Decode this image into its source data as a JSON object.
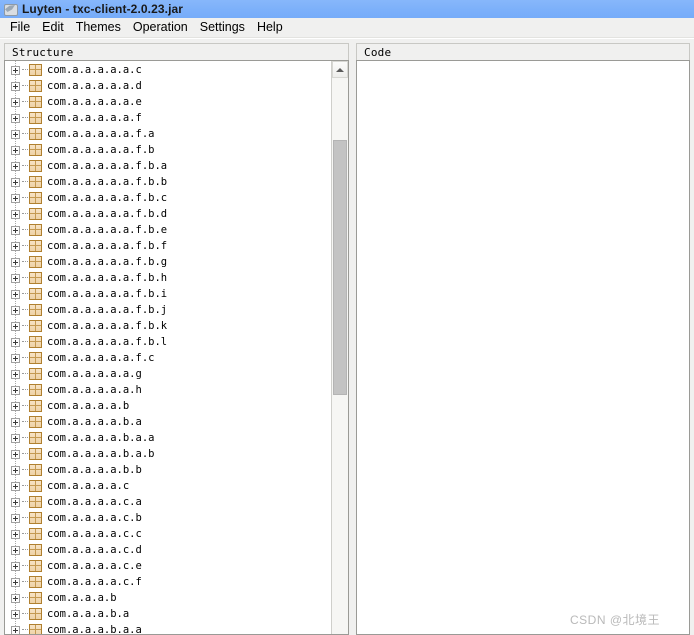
{
  "window": {
    "title": "Luyten - txc-client-2.0.23.jar",
    "icon": "app-icon"
  },
  "menubar": {
    "items": [
      {
        "label": "File"
      },
      {
        "label": "Edit"
      },
      {
        "label": "Themes"
      },
      {
        "label": "Operation"
      },
      {
        "label": "Settings"
      },
      {
        "label": "Help"
      }
    ]
  },
  "structure_panel": {
    "header": "Structure",
    "expander_icon": "plus-square-icon",
    "node_icon": "package-icon",
    "nodes": [
      {
        "label": "com.a.a.a.a.a.c"
      },
      {
        "label": "com.a.a.a.a.a.d"
      },
      {
        "label": "com.a.a.a.a.a.e"
      },
      {
        "label": "com.a.a.a.a.a.f"
      },
      {
        "label": "com.a.a.a.a.a.f.a"
      },
      {
        "label": "com.a.a.a.a.a.f.b"
      },
      {
        "label": "com.a.a.a.a.a.f.b.a"
      },
      {
        "label": "com.a.a.a.a.a.f.b.b"
      },
      {
        "label": "com.a.a.a.a.a.f.b.c"
      },
      {
        "label": "com.a.a.a.a.a.f.b.d"
      },
      {
        "label": "com.a.a.a.a.a.f.b.e"
      },
      {
        "label": "com.a.a.a.a.a.f.b.f"
      },
      {
        "label": "com.a.a.a.a.a.f.b.g"
      },
      {
        "label": "com.a.a.a.a.a.f.b.h"
      },
      {
        "label": "com.a.a.a.a.a.f.b.i"
      },
      {
        "label": "com.a.a.a.a.a.f.b.j"
      },
      {
        "label": "com.a.a.a.a.a.f.b.k"
      },
      {
        "label": "com.a.a.a.a.a.f.b.l"
      },
      {
        "label": "com.a.a.a.a.a.f.c"
      },
      {
        "label": "com.a.a.a.a.a.g"
      },
      {
        "label": "com.a.a.a.a.a.h"
      },
      {
        "label": "com.a.a.a.a.b"
      },
      {
        "label": "com.a.a.a.a.b.a"
      },
      {
        "label": "com.a.a.a.a.b.a.a"
      },
      {
        "label": "com.a.a.a.a.b.a.b"
      },
      {
        "label": "com.a.a.a.a.b.b"
      },
      {
        "label": "com.a.a.a.a.c"
      },
      {
        "label": "com.a.a.a.a.c.a"
      },
      {
        "label": "com.a.a.a.a.c.b"
      },
      {
        "label": "com.a.a.a.a.c.c"
      },
      {
        "label": "com.a.a.a.a.c.d"
      },
      {
        "label": "com.a.a.a.a.c.e"
      },
      {
        "label": "com.a.a.a.a.c.f"
      },
      {
        "label": "com.a.a.a.b"
      },
      {
        "label": "com.a.a.a.b.a"
      },
      {
        "label": "com.a.a.a.b.a.a"
      }
    ],
    "scrollbar": {
      "up_arrow_icon": "chevron-up-icon"
    }
  },
  "code_panel": {
    "header": "Code",
    "content": ""
  },
  "watermark": {
    "text": "CSDN @北境王"
  },
  "colors": {
    "titlebar": "#7cb0fa",
    "menubar": "#f0f0ef",
    "panel_bg": "#ffffff",
    "node_icon": "#eed2a6",
    "scroll_thumb": "#c3c3c3"
  }
}
